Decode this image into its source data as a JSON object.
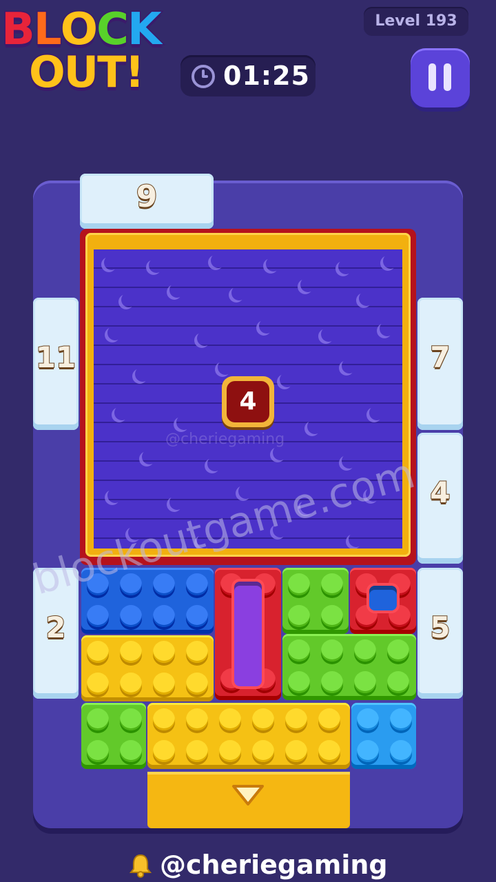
{
  "logo": {
    "line1": [
      "B",
      "L",
      "O",
      "C",
      "K"
    ],
    "line2": [
      "O",
      "U",
      "T",
      "!"
    ]
  },
  "header": {
    "level": "Level 193",
    "timer": "01:25"
  },
  "board": {
    "center_number": "4",
    "watermark_small": "@cheriegaming"
  },
  "gates": {
    "top": "9",
    "left_top": "11",
    "left_bottom": "2",
    "right_top": "7",
    "right_middle": "4",
    "right_bottom": "5"
  },
  "colors": {
    "blue": "#1f63dc",
    "red": "#d8222e",
    "green": "#62c92a",
    "yellow": "#f5c114",
    "cyan": "#2a9cf0",
    "purple": "#8a3fe0"
  },
  "watermark": "blockoutgame.com",
  "footer": {
    "handle": "@cheriegaming"
  }
}
